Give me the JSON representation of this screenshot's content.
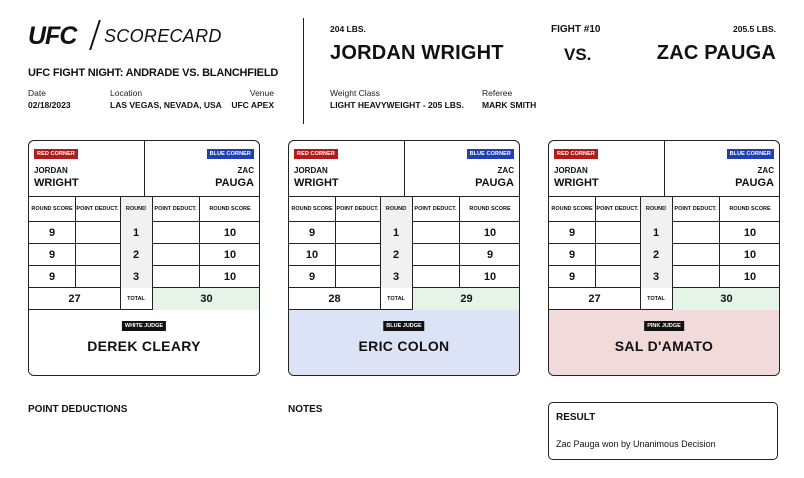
{
  "brand": {
    "logo_text": "UFC",
    "section": "SCORECARD"
  },
  "event": {
    "title": "UFC FIGHT NIGHT: ANDRADE VS. BLANCHFIELD",
    "date_label": "Date",
    "date": "02/18/2023",
    "location_label": "Location",
    "location": "LAS VEGAS, NEVADA, USA",
    "venue_label": "Venue",
    "venue": "UFC APEX",
    "weight_class_label": "Weight Class",
    "weight_class": "LIGHT HEAVYWEIGHT - 205 LBS.",
    "referee_label": "Referee",
    "referee": "MARK SMITH"
  },
  "fight": {
    "number": "FIGHT #10",
    "vs": "VS.",
    "fighter1": {
      "weight": "204 LBS.",
      "name": "JORDAN WRIGHT",
      "first": "JORDAN",
      "last": "WRIGHT"
    },
    "fighter2": {
      "weight": "205.5 LBS.",
      "name": "ZAC PAUGA",
      "first": "ZAC",
      "last": "PAUGA"
    }
  },
  "labels": {
    "red_corner": "RED CORNER",
    "blue_corner": "BLUE CORNER",
    "round_score": "ROUND SCORE",
    "point_deduct": "POINT DEDUCT.",
    "round": "ROUND",
    "total": "TOTAL"
  },
  "judges": [
    {
      "badge": "WHITE JUDGE",
      "name": "DEREK CLEARY",
      "color": "#ffffff",
      "badge_color": "#111111",
      "rounds": [
        {
          "round": "1",
          "red": "9",
          "blue": "10"
        },
        {
          "round": "2",
          "red": "9",
          "blue": "10"
        },
        {
          "round": "3",
          "red": "9",
          "blue": "10"
        }
      ],
      "total_red": "27",
      "total_blue": "30"
    },
    {
      "badge": "BLUE JUDGE",
      "name": "ERIC COLON",
      "color": "#dde3f7",
      "badge_color": "#111111",
      "rounds": [
        {
          "round": "1",
          "red": "9",
          "blue": "10"
        },
        {
          "round": "2",
          "red": "10",
          "blue": "9"
        },
        {
          "round": "3",
          "red": "9",
          "blue": "10"
        }
      ],
      "total_red": "28",
      "total_blue": "29"
    },
    {
      "badge": "PINK JUDGE",
      "name": "SAL D'AMATO",
      "color": "#f3dada",
      "badge_color": "#111111",
      "rounds": [
        {
          "round": "1",
          "red": "9",
          "blue": "10"
        },
        {
          "round": "2",
          "red": "9",
          "blue": "10"
        },
        {
          "round": "3",
          "red": "9",
          "blue": "10"
        }
      ],
      "total_red": "27",
      "total_blue": "30"
    }
  ],
  "sections": {
    "point_deductions": "POINT DEDUCTIONS",
    "notes": "NOTES",
    "result_title": "RESULT",
    "result_text": "Zac Pauga won by Unanimous Decision"
  },
  "colors": {
    "red_corner": "#b01b1b",
    "blue_corner": "#1f3fb7",
    "total_highlight": "#e4f4e6"
  }
}
